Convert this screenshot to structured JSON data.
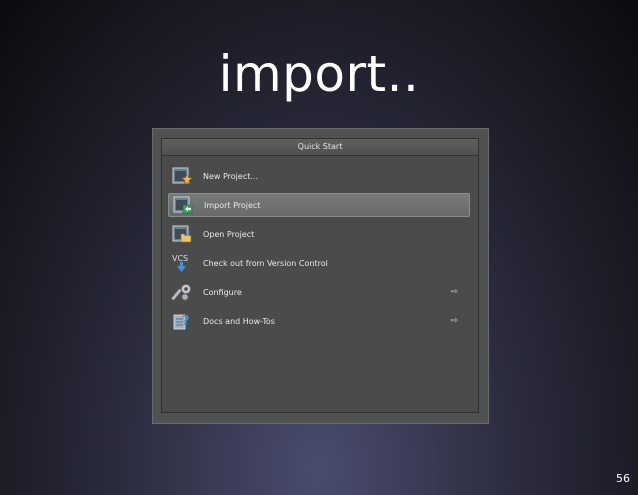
{
  "slide": {
    "title": "import..",
    "page_number": "56"
  },
  "dialog": {
    "header": "Quick Start",
    "items": [
      {
        "label": "New Project...",
        "icon": "new-project-icon",
        "submenu": false,
        "selected": false
      },
      {
        "label": "Import Project",
        "icon": "import-project-icon",
        "submenu": false,
        "selected": true
      },
      {
        "label": "Open Project",
        "icon": "open-project-icon",
        "submenu": false,
        "selected": false
      },
      {
        "label": "Check out from Version Control",
        "icon": "vcs-icon",
        "submenu": false,
        "selected": false
      },
      {
        "label": "Configure",
        "icon": "configure-icon",
        "submenu": true,
        "selected": false
      },
      {
        "label": "Docs and How-Tos",
        "icon": "docs-icon",
        "submenu": true,
        "selected": false
      }
    ],
    "arrow_glyph": "⇨"
  },
  "colors": {
    "selected_item": "#737575",
    "panel": "#4a4c4c"
  }
}
